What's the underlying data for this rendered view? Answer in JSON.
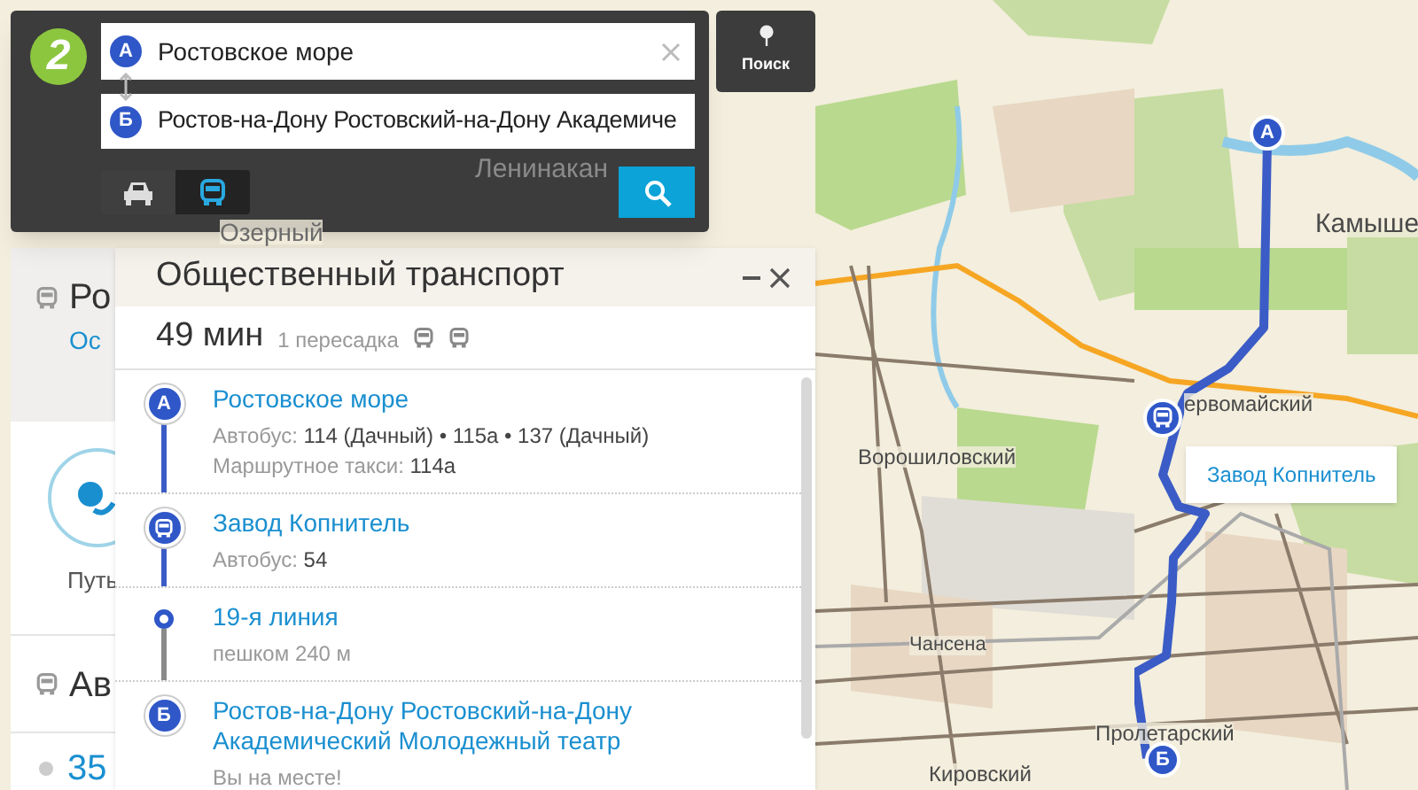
{
  "route_form": {
    "logo": "2",
    "from": {
      "marker": "А",
      "value": "Ростовское море"
    },
    "to": {
      "marker": "Б",
      "value": "Ростов-на-Дону Ростовский-на-Дону Академиче"
    },
    "modes": [
      {
        "kind": "car",
        "selected": false
      },
      {
        "kind": "bus",
        "selected": true
      }
    ]
  },
  "search_tab": {
    "label": "Поиск"
  },
  "side_list": {
    "title": "Ро",
    "subtitle": "Ос",
    "path_label": "Путь",
    "second_title": "Ав",
    "number": "35"
  },
  "transport_panel": {
    "title": "Общественный транспорт",
    "duration": "49 мин",
    "transfers": "1 пересадка",
    "stops": [
      {
        "kind": "start",
        "marker": "А",
        "name": "Ростовское море",
        "walking": false,
        "details": [
          {
            "label": "Автобус:",
            "value": "114 (Дачный) • 115а • 137 (Дачный)"
          },
          {
            "label": "Маршрутное такси:",
            "value": "114а"
          }
        ]
      },
      {
        "kind": "bus",
        "name": "Завод Копнитель",
        "walking": false,
        "details": [
          {
            "label": "Автобус:",
            "value": "54"
          }
        ]
      },
      {
        "kind": "walk",
        "name": "19-я линия",
        "walking": true,
        "details": [
          {
            "label": "пешком 240 м"
          }
        ]
      },
      {
        "kind": "end",
        "marker": "Б",
        "name": "Ростов-на-Дону Ростовский-на-Дону Академический Молодежный театр",
        "details": [
          {
            "label": "Вы на месте!"
          }
        ]
      }
    ]
  },
  "map": {
    "labels": [
      "Ленинакан",
      "Озерный",
      "Камыше",
      "ервомайский",
      "Ворошиловский",
      "Чансена",
      "Пролетарский",
      "Кировский"
    ],
    "start_marker": "А",
    "end_marker": "Б",
    "callout": "Завод Копнитель"
  }
}
